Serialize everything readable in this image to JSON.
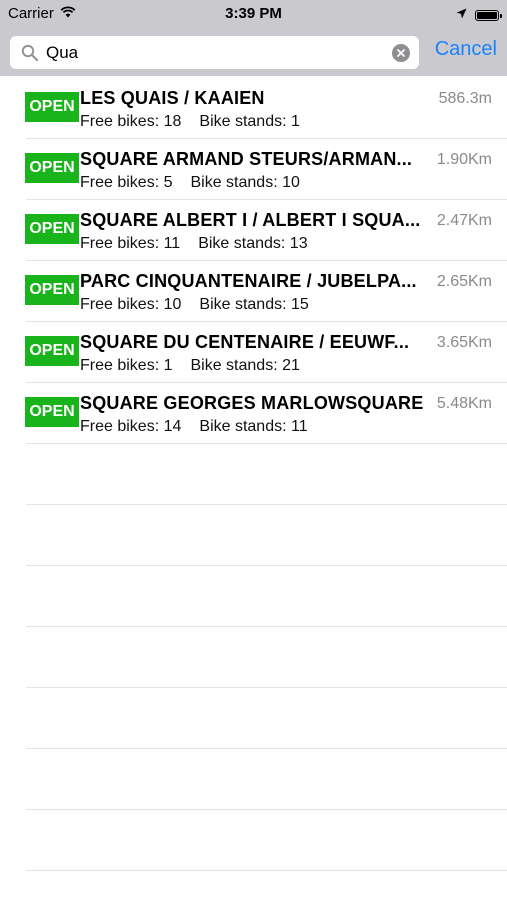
{
  "status_bar": {
    "carrier": "Carrier",
    "time": "3:39 PM",
    "icons": [
      "wifi-icon",
      "location-arrow-icon",
      "battery-icon"
    ]
  },
  "search": {
    "value": "Qua",
    "cancel_label": "Cancel",
    "accent_color": "#1a82fb"
  },
  "colors": {
    "badge_open": "#19b41b",
    "header_bg": "#c9c9ce"
  },
  "stations": [
    {
      "status": "OPEN",
      "name": "LES QUAIS / KAAIEN",
      "distance": "586.3m",
      "free_bikes_label": "Free bikes: 18",
      "bike_stands_label": "Bike stands: 1"
    },
    {
      "status": "OPEN",
      "name": "SQUARE ARMAND STEURS/ARMAN...",
      "distance": "1.90Km",
      "free_bikes_label": "Free bikes: 5",
      "bike_stands_label": "Bike stands: 10"
    },
    {
      "status": "OPEN",
      "name": "SQUARE ALBERT I / ALBERT I SQUA...",
      "distance": "2.47Km",
      "free_bikes_label": "Free bikes: 11",
      "bike_stands_label": "Bike stands: 13"
    },
    {
      "status": "OPEN",
      "name": "PARC CINQUANTENAIRE / JUBELPA...",
      "distance": "2.65Km",
      "free_bikes_label": "Free bikes: 10",
      "bike_stands_label": "Bike stands: 15"
    },
    {
      "status": "OPEN",
      "name": "SQUARE DU CENTENAIRE / EEUWF...",
      "distance": "3.65Km",
      "free_bikes_label": "Free bikes: 1",
      "bike_stands_label": "Bike stands: 21"
    },
    {
      "status": "OPEN",
      "name": "SQUARE GEORGES MARLOWSQUARE",
      "distance": "5.48Km",
      "free_bikes_label": "Free bikes: 14",
      "bike_stands_label": "Bike stands: 11"
    }
  ]
}
